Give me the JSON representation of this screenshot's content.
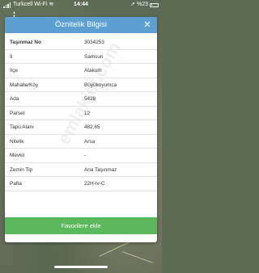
{
  "status_bar": {
    "carrier": "Turkcell Wi-Fi",
    "time": "14:44",
    "battery_percent": "%23"
  },
  "dialog": {
    "title": "Öznitelik Bilgisi",
    "close_icon": "close-icon",
    "rows": [
      {
        "label": "Taşınmaz No",
        "value": "3034253"
      },
      {
        "label": "İl",
        "value": "Samsun"
      },
      {
        "label": "İlçe",
        "value": "Atakum"
      },
      {
        "label": "Mahalle/Köy",
        "value": "Büyükoyumca"
      },
      {
        "label": "Ada",
        "value": "5428"
      },
      {
        "label": "Parsel",
        "value": "12"
      },
      {
        "label": "Tapu Alanı",
        "value": "482,65"
      },
      {
        "label": "Nitelik",
        "value": "Arsa"
      },
      {
        "label": "Mevkii",
        "value": "-"
      },
      {
        "label": "Zemin Tip",
        "value": "Ana Taşınmaz"
      },
      {
        "label": "Pafta",
        "value": "22H-Iv-C"
      }
    ],
    "favorite_button_label": "Favorilere ekle"
  },
  "watermark": "emlakjet.com",
  "colors": {
    "header": "#5b9fd3",
    "favorite_button": "#5cb85c"
  }
}
